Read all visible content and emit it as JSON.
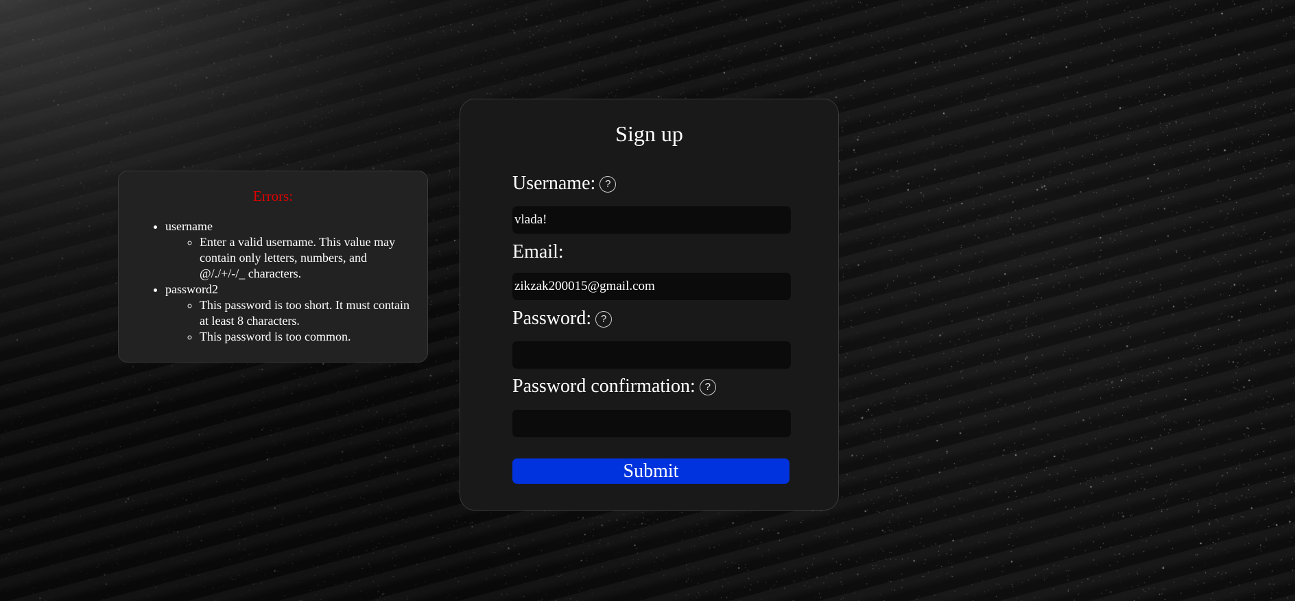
{
  "errors": {
    "title": "Errors:",
    "fields": [
      {
        "name": "username",
        "messages": [
          "Enter a valid username. This value may contain only letters, numbers, and @/./+/-/_ characters."
        ]
      },
      {
        "name": "password2",
        "messages": [
          "This password is too short. It must contain at least 8 characters.",
          "This password is too common."
        ]
      }
    ]
  },
  "form": {
    "title": "Sign up",
    "help_icon": "?",
    "username": {
      "label": "Username:",
      "value": "vlada!"
    },
    "email": {
      "label": "Email:",
      "value": "zikzak200015@gmail.com"
    },
    "password": {
      "label": "Password:",
      "value": ""
    },
    "password_confirmation": {
      "label": "Password confirmation:",
      "value": ""
    },
    "submit_label": "Submit"
  },
  "colors": {
    "error_title": "#e00000",
    "submit_button": "#0033dd",
    "card_background": "#191919",
    "errors_background": "#222222",
    "input_background": "#0b0b0b"
  }
}
